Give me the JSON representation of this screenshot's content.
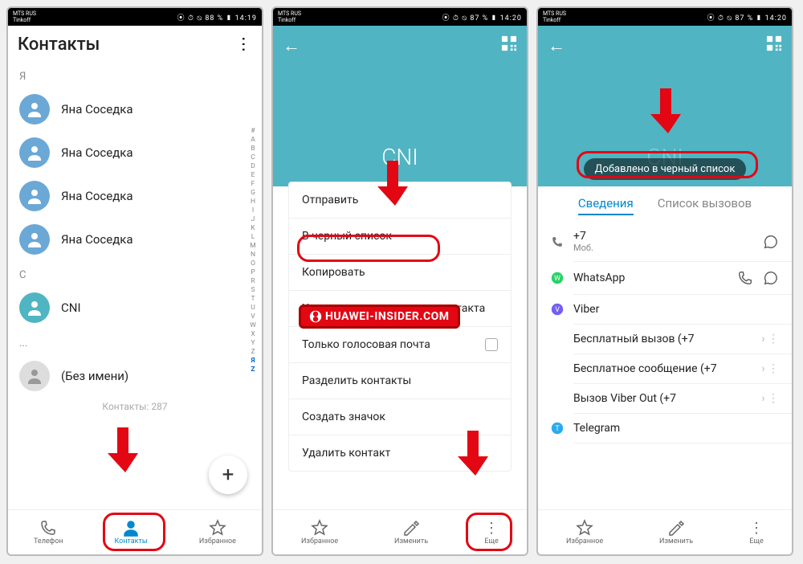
{
  "statusbar": {
    "carrier": "MTS RUS",
    "sub": "Tinkoff",
    "icons_time_1": "⦿ ⏱ ⦰ 88 % ▮ 14:19",
    "icons_time_2": "⦿ ⏱ ⦰ 87 % ▮ 14:20",
    "icons_time_3": "⦿ ⏱ ⦰ 87 % ▮ 14:20"
  },
  "screen1": {
    "title": "Контакты",
    "sections": [
      {
        "label": "Я",
        "items": [
          {
            "name": "Яна Соседка"
          },
          {
            "name": "Яна Соседка"
          },
          {
            "name": "Яна Соседка"
          },
          {
            "name": "Яна Соседка"
          }
        ]
      },
      {
        "label": "C",
        "items": [
          {
            "name": "CNI",
            "teal": true
          }
        ]
      },
      {
        "label": "...",
        "items": [
          {
            "name": "(Без имени)",
            "gray": true
          }
        ]
      }
    ],
    "count": "Контакты: 287",
    "nav": [
      {
        "label": "Телефон"
      },
      {
        "label": "Контакты",
        "active": true
      },
      {
        "label": "Избранное"
      }
    ],
    "alpha": [
      "#",
      "A",
      "B",
      "C",
      "D",
      "E",
      "F",
      "G",
      "H",
      "I",
      "J",
      "K",
      "L",
      "M",
      "N",
      "O",
      "P",
      "R",
      "S",
      "T",
      "U",
      "V",
      "W",
      "X",
      "Y",
      "Z",
      "Я",
      "Z"
    ]
  },
  "screen2": {
    "contact": "CNI",
    "menu": [
      {
        "label": "Отправить"
      },
      {
        "label": "В черный список",
        "hl": true
      },
      {
        "label": "Копировать",
        "icon": "whatsapp"
      },
      {
        "label": "Удалить все упоминания контакта",
        "icon": "viber"
      },
      {
        "label": "Только голосовая почта",
        "check": true
      },
      {
        "label": "Разделить контакты"
      },
      {
        "label": "Создать значок"
      },
      {
        "label": "Удалить контакт",
        "icon": "telegram"
      }
    ],
    "nav": [
      {
        "label": "Избранное",
        "icon": "star"
      },
      {
        "label": "Изменить",
        "icon": "edit"
      },
      {
        "label": "Еще",
        "icon": "more",
        "hl": true
      }
    ]
  },
  "screen3": {
    "contact": "CNI",
    "toast": "Добавлено в черный список",
    "tabs": [
      {
        "label": "Сведения",
        "active": true
      },
      {
        "label": "Список вызовов"
      }
    ],
    "rows": [
      {
        "icon": "phone",
        "label": "+7",
        "sub": "Моб.",
        "actions": [
          "chat"
        ]
      },
      {
        "icon": "whatsapp",
        "label": "WhatsApp",
        "actions": [
          "call",
          "chat"
        ]
      },
      {
        "icon": "viber",
        "label": "Viber"
      },
      {
        "label": "Бесплатный вызов (+7",
        "chev": true,
        "dots": true
      },
      {
        "label": "Бесплатное сообщение (+7",
        "chev": true,
        "dots": true
      },
      {
        "label": "Вызов Viber Out (+7",
        "chev": true,
        "dots": true
      },
      {
        "icon": "telegram",
        "label": "Telegram"
      }
    ],
    "nav": [
      {
        "label": "Избранное",
        "icon": "star"
      },
      {
        "label": "Изменить",
        "icon": "edit"
      },
      {
        "label": "Еще",
        "icon": "more"
      }
    ]
  },
  "watermark": "HUAWEI-INSIDER.COM"
}
